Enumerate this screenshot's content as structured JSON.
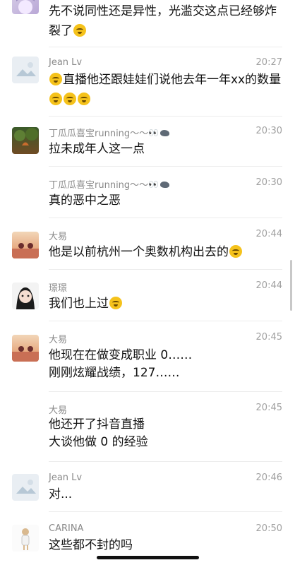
{
  "messages": [
    {
      "name": "",
      "time": "",
      "text": "先不说同性还是异性，光滥交这点已经够炸裂了"
    },
    {
      "name": "Jean Lv",
      "time": "20:27",
      "text": "直播他还跟娃娃们说他去年一年xx的数量"
    },
    {
      "name": "丁瓜瓜喜宝running～～",
      "time": "20:30",
      "text": "拉未成年人这一点"
    },
    {
      "name": "丁瓜瓜喜宝running～～",
      "time": "20:30",
      "text": "真的恶中之恶"
    },
    {
      "name": "大易",
      "time": "20:44",
      "text": "他是以前杭州一个奥数机构出去的"
    },
    {
      "name": "璟璟",
      "time": "20:44",
      "text": "我们也上过"
    },
    {
      "name": "大易",
      "time": "20:45",
      "text": "他现在在做变成职业 0……",
      "text2": "刚刚炫耀战绩，127……"
    },
    {
      "name": "大易",
      "time": "20:45",
      "text": "他还开了抖音直播",
      "text2": "大谈他做 0 的经验"
    },
    {
      "name": "Jean Lv",
      "time": "20:46",
      "text": "对..."
    },
    {
      "name": "CARINA",
      "time": "20:50",
      "text": "这些都不封的吗"
    }
  ],
  "icons": {
    "emoji": "laughing-crying-emoji",
    "eyes": "eyes-emoji",
    "bird": "bird-emoji"
  },
  "colors": {
    "name": "#8a8a8a",
    "time": "#a0a0a0",
    "text": "#111111",
    "separator": "#ececec"
  }
}
